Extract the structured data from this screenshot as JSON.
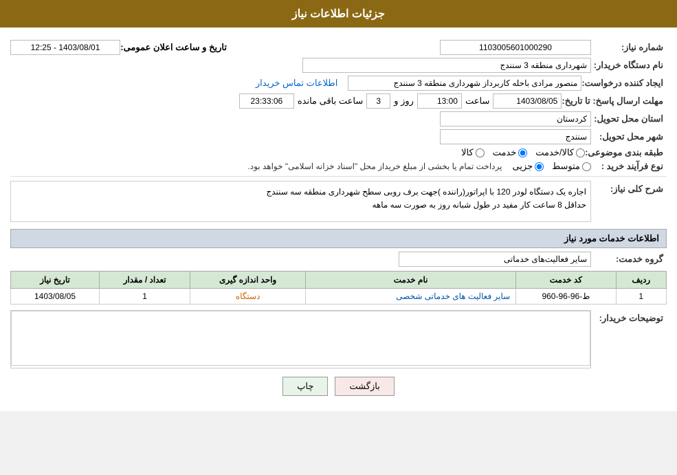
{
  "header": {
    "title": "جزئیات اطلاعات نیاز"
  },
  "fields": {
    "need_number_label": "شماره نیاز:",
    "need_number_value": "1103005601000290",
    "buyer_org_label": "نام دستگاه خریدار:",
    "buyer_org_value": "شهرداری منطقه 3 سنندج",
    "creator_label": "ایجاد کننده درخواست:",
    "creator_value": "منصور مرادی باحله کاربرداز شهرداری منطقه 3 سنندج",
    "contact_link": "اطلاعات تماس خریدار",
    "deadline_label": "مهلت ارسال پاسخ: تا تاریخ:",
    "date_value": "1403/08/05",
    "time_label": "ساعت",
    "time_value": "13:00",
    "day_label": "روز و",
    "day_value": "3",
    "remaining_label": "ساعت باقی مانده",
    "remaining_value": "23:33:06",
    "datetime_label": "تاریخ و ساعت اعلان عمومی:",
    "datetime_value": "1403/08/01 - 12:25",
    "province_label": "استان محل تحویل:",
    "province_value": "کردستان",
    "city_label": "شهر محل تحویل:",
    "city_value": "سنندج",
    "category_label": "طبقه بندی موضوعی:",
    "category_radio_kala": "کالا",
    "category_radio_khedmat": "خدمت",
    "category_radio_kala_khedmat": "کالا/خدمت",
    "category_selected": "khedmat",
    "purchase_type_label": "نوع فرآیند خرید :",
    "purchase_radio_jazii": "جزیی",
    "purchase_radio_mootaset": "متوسط",
    "purchase_note": "پرداخت تمام یا بخشی از مبلغ خریداز محل \"اسناد خزانه اسلامی\" خواهد بود.",
    "description_label": "شرح کلی نیاز:",
    "description_text": "اجاره یک دستگاه لودر 120 با اپراتور(راننده )جهت برف روبی سطح شهرداری منطقه سه سنندج\nحداقل 8 ساعت کار مفید در طول شبانه روز به صورت سه ماهه",
    "services_title": "اطلاعات خدمات مورد نیاز",
    "service_group_label": "گروه خدمت:",
    "service_group_value": "سایر فعالیت‌های خدماتی",
    "table_headers": [
      "ردیف",
      "کد خدمت",
      "نام خدمت",
      "واحد اندازه گیری",
      "تعداد / مقدار",
      "تاریخ نیاز"
    ],
    "table_rows": [
      {
        "row": "1",
        "code": "ط-96-96-960",
        "name": "سایر فعالیت های خدماتی شخصی",
        "unit": "دستگاه",
        "quantity": "1",
        "date": "1403/08/05"
      }
    ],
    "buyer_desc_label": "توضیحات خریدار:",
    "buyer_desc_value": "",
    "btn_print": "چاپ",
    "btn_back": "بازگشت"
  }
}
